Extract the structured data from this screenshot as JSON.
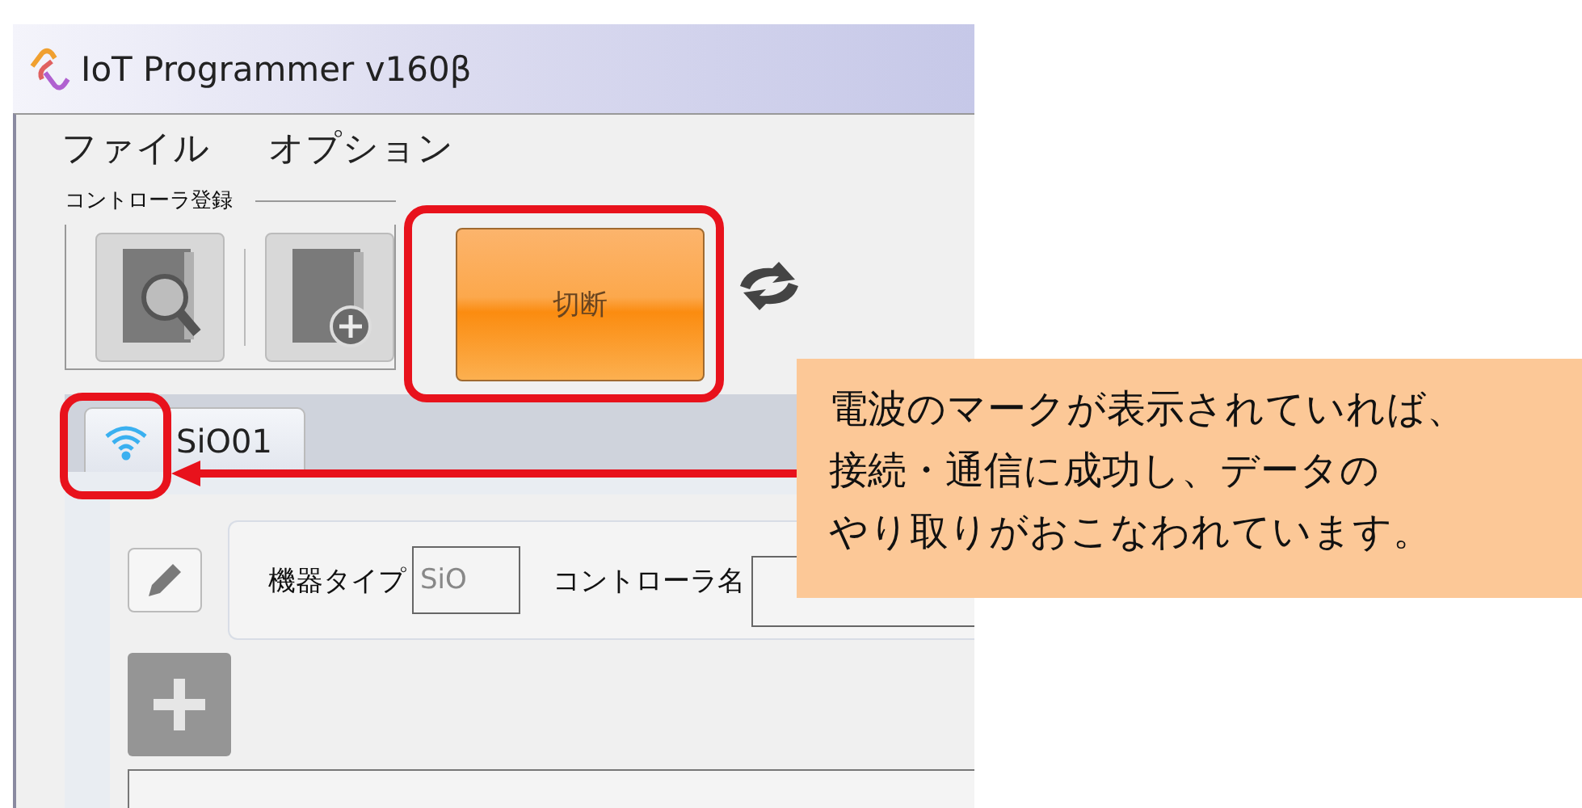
{
  "window": {
    "title": "IoT Programmer v160β"
  },
  "menu": [
    {
      "label": "ファイル"
    },
    {
      "label": "オプション"
    }
  ],
  "controller_group": {
    "label": "コントローラ登録"
  },
  "disconnect_button": {
    "label": "切断"
  },
  "tabs": [
    {
      "label": "SiO01",
      "selected": true,
      "connected": true
    }
  ],
  "device_type": {
    "label": "機器タイプ",
    "value": "SiO"
  },
  "controller_name": {
    "label": "コントローラ名"
  },
  "callout": {
    "lines": [
      "電波のマークが表示されていれば、",
      "接続・通信に成功し、データの",
      "やり取りがおこなわれています。"
    ]
  }
}
